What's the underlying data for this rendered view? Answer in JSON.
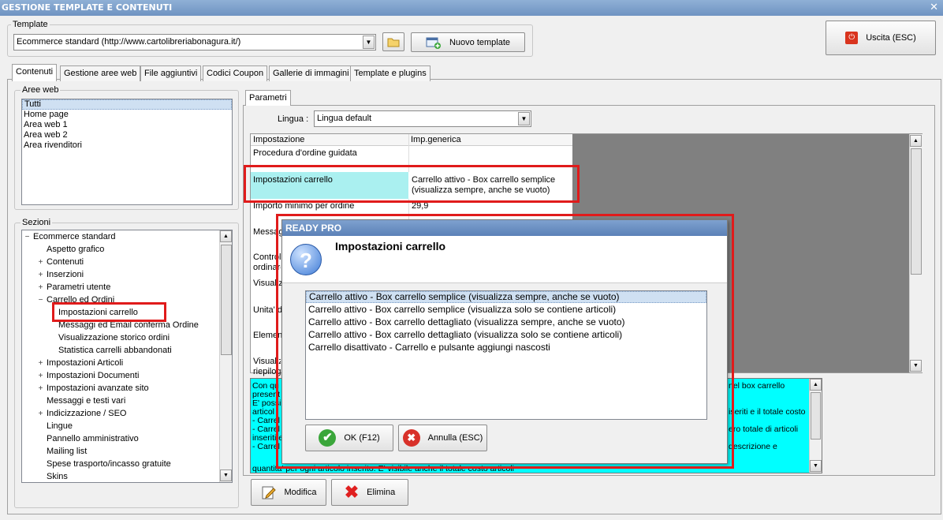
{
  "window": {
    "title": "GESTIONE TEMPLATE E CONTENUTI",
    "close": "✕"
  },
  "template": {
    "group_label": "Template",
    "selected": "Ecommerce standard (http://www.cartolibreriabonagura.it/)",
    "new_button": "Nuovo template"
  },
  "exit_button": "Uscita (ESC)",
  "tabs": [
    "Contenuti",
    "Gestione aree web",
    "File aggiuntivi",
    "Codici Coupon",
    "Gallerie di immagini",
    "Template e plugins"
  ],
  "aree_web": {
    "label": "Aree web",
    "items": [
      "Tutti",
      "Home page",
      "Area web 1",
      "Area web 2",
      "Area rivenditori"
    ]
  },
  "sezioni": {
    "label": "Sezioni",
    "nodes": [
      {
        "text": "Ecommerce standard",
        "pm": "−"
      },
      {
        "text": "Aspetto grafico",
        "pm": ""
      },
      {
        "text": "Contenuti",
        "pm": "+"
      },
      {
        "text": "Inserzioni",
        "pm": "+"
      },
      {
        "text": "Parametri utente",
        "pm": "+"
      },
      {
        "text": "Carrello ed Ordini",
        "pm": "−"
      },
      {
        "text": "Impostazioni carrello",
        "pm": ""
      },
      {
        "text": "Messaggi ed Email conferma Ordine",
        "pm": ""
      },
      {
        "text": "Visualizzazione storico ordini",
        "pm": ""
      },
      {
        "text": "Statistica carrelli abbandonati",
        "pm": ""
      },
      {
        "text": "Impostazioni Articoli",
        "pm": "+"
      },
      {
        "text": "Impostazioni Documenti",
        "pm": "+"
      },
      {
        "text": "Impostazioni avanzate sito",
        "pm": "+"
      },
      {
        "text": "Messaggi e testi vari",
        "pm": ""
      },
      {
        "text": "Indicizzazione / SEO",
        "pm": "+"
      },
      {
        "text": "Lingue",
        "pm": ""
      },
      {
        "text": "Pannello amministrativo",
        "pm": ""
      },
      {
        "text": "Mailing list",
        "pm": ""
      },
      {
        "text": "Spese trasporto/incasso gratuite",
        "pm": ""
      },
      {
        "text": "Skins",
        "pm": ""
      }
    ]
  },
  "parametri": {
    "tab": "Parametri",
    "lingua_label": "Lingua :",
    "lingua_value": "Lingua default",
    "col_headers": [
      "Impostazione",
      "Imp.generica"
    ],
    "rows": [
      {
        "k": "Procedura d'ordine guidata",
        "v": ""
      },
      {
        "k": "Impostazioni carrello",
        "v": "Carrello attivo - Box carrello semplice (visualizza sempre, anche se vuoto)"
      },
      {
        "k": "Importo minimo per ordine",
        "v": "29,9"
      },
      {
        "k": "Messag",
        "v": ""
      },
      {
        "k": "Control ordinare",
        "v": ""
      },
      {
        "k": "Visualiz",
        "v": ""
      },
      {
        "k": "Unita' d",
        "v": ""
      },
      {
        "k": "Elemen",
        "v": ""
      },
      {
        "k": "Visualiz riepilog",
        "v": ""
      }
    ]
  },
  "description": {
    "left_lines": [
      "Con qu",
      "present",
      "E' possi",
      "articol",
      "- Carrel",
      "- Carrel",
      "inseriti e",
      "- Carrel"
    ],
    "right_lines": [
      "nel box carrello",
      "",
      "",
      "iseriti e il totale costo",
      "",
      "ero totale di articoli",
      "",
      "descrizione e"
    ],
    "bottom_line": "quantita' per ogni articolo inserito. E' visibile anche il totale costo articoli"
  },
  "bottom_buttons": {
    "modifica": "Modifica",
    "elimina": "Elimina"
  },
  "dialog": {
    "title": "READY PRO",
    "heading": "Impostazioni carrello",
    "options": [
      "Carrello attivo - Box carrello semplice (visualizza sempre, anche se vuoto)",
      "Carrello attivo - Box carrello semplice (visualizza solo se contiene articoli)",
      "Carrello attivo - Box carrello dettagliato (visualizza sempre, anche se vuoto)",
      "Carrello attivo - Box carrello dettagliato (visualizza solo se contiene articoli)",
      "Carrello disattivato - Carrello e pulsante aggiungi nascosti"
    ],
    "ok": "OK (F12)",
    "cancel": "Annulla (ESC)"
  },
  "colors": {
    "highlight_red": "#e01b1b",
    "cyan_desc": "#00ffff",
    "selection_row": "#aaf0f0",
    "title_blue": "#6f93c2"
  }
}
